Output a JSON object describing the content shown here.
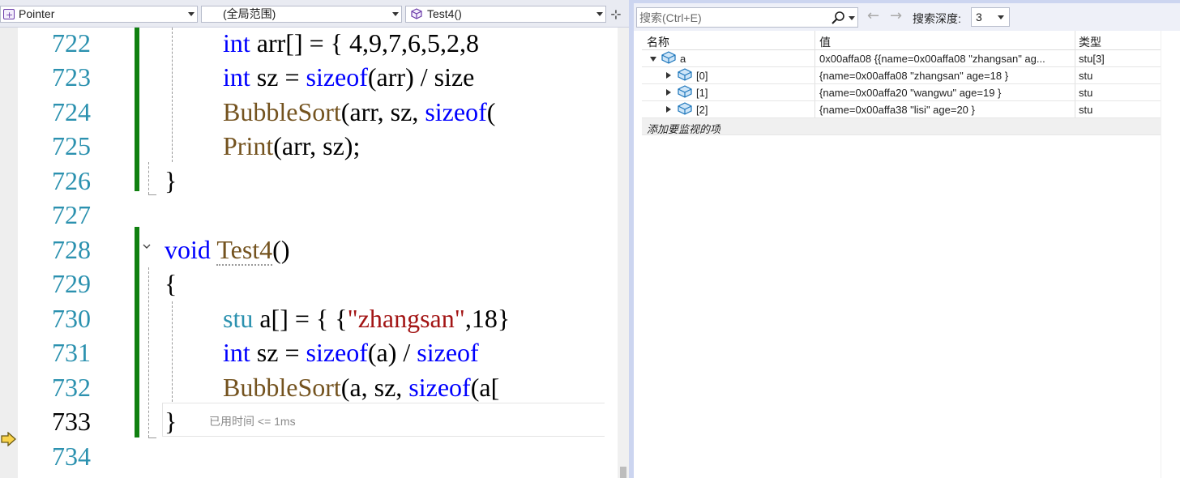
{
  "editor": {
    "nav": {
      "project": "Pointer",
      "scope": "(全局范围)",
      "member": "Test4()"
    },
    "lines": [
      {
        "num": "722",
        "current": false
      },
      {
        "num": "723",
        "current": false
      },
      {
        "num": "724",
        "current": false
      },
      {
        "num": "725",
        "current": false
      },
      {
        "num": "726",
        "current": false
      },
      {
        "num": "727",
        "current": false
      },
      {
        "num": "728",
        "current": false
      },
      {
        "num": "729",
        "current": false
      },
      {
        "num": "730",
        "current": false
      },
      {
        "num": "731",
        "current": false
      },
      {
        "num": "732",
        "current": false
      },
      {
        "num": "733",
        "current": true
      },
      {
        "num": "734",
        "current": false
      }
    ],
    "code": {
      "l722": {
        "kw": "int",
        "rest": " arr[] = { 4,9,7,6,5,2,8"
      },
      "l723": {
        "kw": "int",
        "var1": " sz",
        "op": " = ",
        "kw2": "sizeof",
        "rest": "(arr) / size"
      },
      "l724": {
        "fn": "BubbleSort",
        "rest": "(arr, sz, ",
        "kw": "sizeof",
        "tail": "("
      },
      "l725": {
        "fn": "Print",
        "rest": "(arr, sz);"
      },
      "l726": {
        "brace": "}"
      },
      "l728": {
        "kw": "void",
        "fn": "Test4",
        "rest": "()"
      },
      "l729": {
        "brace": "{"
      },
      "l730": {
        "ty": "stu",
        "rest1": " a[] = { {",
        "str": "\"zhangsan\"",
        "rest2": ",18}"
      },
      "l731": {
        "kw": "int",
        "var1": " sz",
        "op": " = ",
        "kw2": "sizeof",
        "rest": "(a) / ",
        "kw3": "sizeof"
      },
      "l732": {
        "fn": "BubbleSort",
        "rest": "(a, sz, ",
        "kw": "sizeof",
        "tail": "(a["
      },
      "l733": {
        "brace": "}"
      }
    },
    "elapsed": "已用时间 <= 1ms",
    "colors": {
      "keyword": "#0000ff",
      "type": "#2b91af",
      "function": "#74531f",
      "string": "#a31515",
      "changebar": "#108010"
    }
  },
  "watch": {
    "search": {
      "placeholder": "搜索(Ctrl+E)",
      "value": ""
    },
    "depth_label": "搜索深度:",
    "depth_value": "3",
    "headers": {
      "name": "名称",
      "value": "值",
      "type": "类型"
    },
    "rows": [
      {
        "name": "a",
        "value": "0x00affa08 {{name=0x00affa08 \"zhangsan\" ag...",
        "type": "stu[3]",
        "expanded": true
      },
      {
        "name": "[0]",
        "value": "{name=0x00affa08 \"zhangsan\" age=18 }",
        "type": "stu",
        "expanded": false
      },
      {
        "name": "[1]",
        "value": "{name=0x00affa20 \"wangwu\" age=19 }",
        "type": "stu",
        "expanded": false
      },
      {
        "name": "[2]",
        "value": "{name=0x00affa38 \"lisi\" age=20 }",
        "type": "stu",
        "expanded": false
      }
    ],
    "add_item": "添加要监视的项"
  }
}
